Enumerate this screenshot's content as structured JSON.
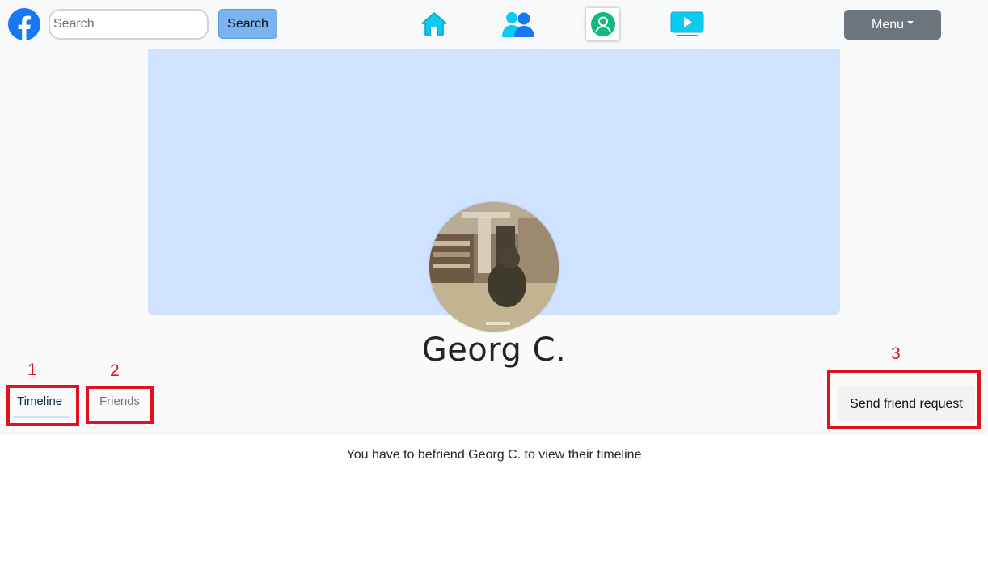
{
  "navbar": {
    "search_placeholder": "Search",
    "search_button": "Search",
    "menu_label": "Menu",
    "icons": [
      "facebook-logo-icon",
      "home-icon",
      "friends-icon",
      "profile-icon",
      "watch-icon"
    ]
  },
  "profile": {
    "name": "Georg C.",
    "cover_color": "#cfe2ff",
    "tabs": [
      {
        "label": "Timeline",
        "active": true
      },
      {
        "label": "Friends",
        "active": false
      }
    ],
    "friend_request_label": "Send friend request"
  },
  "annotations": [
    "1",
    "2",
    "3"
  ],
  "timeline_message": "You have to befriend Georg C. to view their timeline",
  "colors": {
    "accent": "#1877f2",
    "icon_cyan": "#0dcaf0",
    "annotation_red": "#e0101f"
  }
}
